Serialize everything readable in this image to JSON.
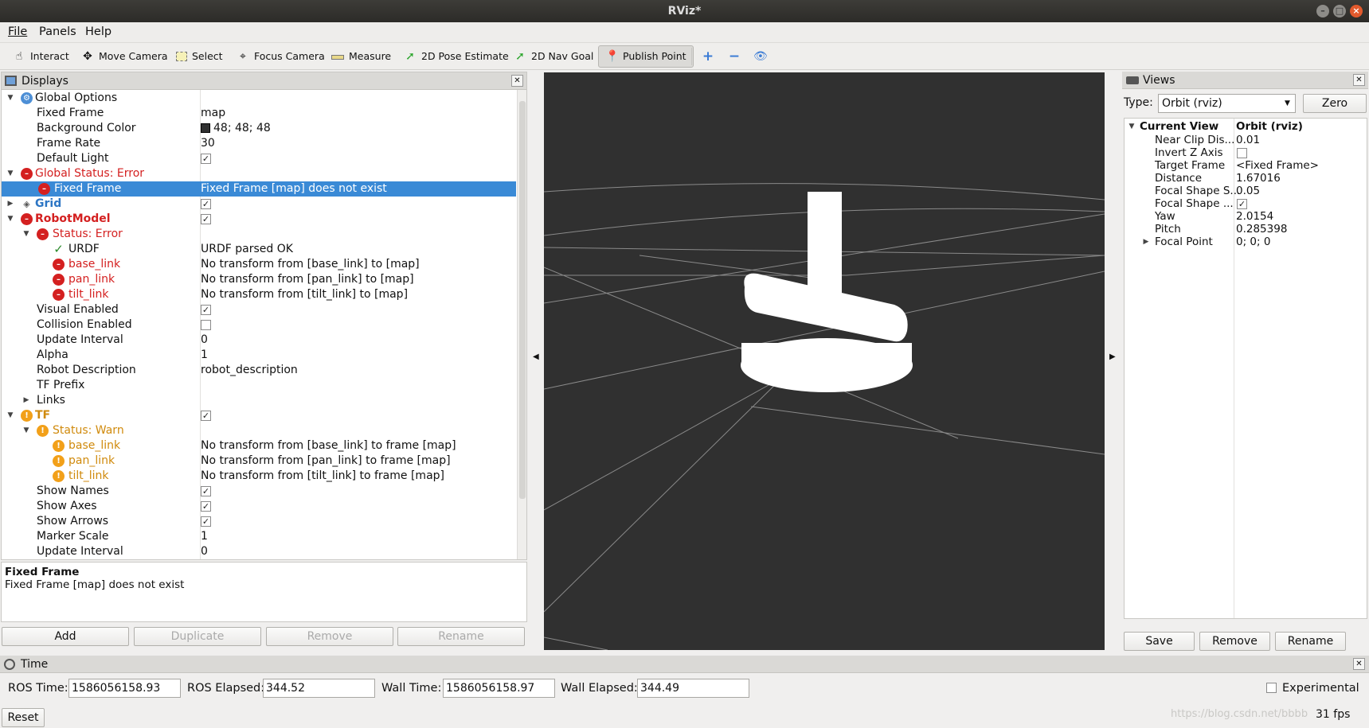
{
  "window": {
    "title": "RViz*"
  },
  "menu": {
    "file": "File",
    "panels": "Panels",
    "help": "Help"
  },
  "toolbar": {
    "interact": "Interact",
    "move_camera": "Move Camera",
    "select": "Select",
    "focus_camera": "Focus Camera",
    "measure": "Measure",
    "pose_estimate": "2D Pose Estimate",
    "nav_goal": "2D Nav Goal",
    "publish_point": "Publish Point",
    "active_tool": "Publish Point"
  },
  "displays": {
    "title": "Displays",
    "rows": [
      {
        "label": "Global Options",
        "value": ""
      },
      {
        "label": "Fixed Frame",
        "value": "map"
      },
      {
        "label": "Background Color",
        "value": "48; 48; 48"
      },
      {
        "label": "Frame Rate",
        "value": "30"
      },
      {
        "label": "Default Light",
        "value": ""
      },
      {
        "label": "Global Status: Error",
        "value": ""
      },
      {
        "label": "Fixed Frame",
        "value": "Fixed Frame [map] does not exist"
      },
      {
        "label": "Grid",
        "value": ""
      },
      {
        "label": "RobotModel",
        "value": ""
      },
      {
        "label": "Status: Error",
        "value": ""
      },
      {
        "label": "URDF",
        "value": "URDF parsed OK"
      },
      {
        "label": "base_link",
        "value": "No transform from [base_link] to [map]"
      },
      {
        "label": "pan_link",
        "value": "No transform from [pan_link] to [map]"
      },
      {
        "label": "tilt_link",
        "value": "No transform from [tilt_link] to [map]"
      },
      {
        "label": "Visual Enabled",
        "value": ""
      },
      {
        "label": "Collision Enabled",
        "value": ""
      },
      {
        "label": "Update Interval",
        "value": "0"
      },
      {
        "label": "Alpha",
        "value": "1"
      },
      {
        "label": "Robot Description",
        "value": "robot_description"
      },
      {
        "label": "TF Prefix",
        "value": ""
      },
      {
        "label": "Links",
        "value": ""
      },
      {
        "label": "TF",
        "value": ""
      },
      {
        "label": "Status: Warn",
        "value": ""
      },
      {
        "label": "base_link",
        "value": "No transform from [base_link] to frame [map]"
      },
      {
        "label": "pan_link",
        "value": "No transform from [pan_link] to frame [map]"
      },
      {
        "label": "tilt_link",
        "value": "No transform from [tilt_link] to frame [map]"
      },
      {
        "label": "Show Names",
        "value": ""
      },
      {
        "label": "Show Axes",
        "value": ""
      },
      {
        "label": "Show Arrows",
        "value": ""
      },
      {
        "label": "Marker Scale",
        "value": "1"
      },
      {
        "label": "Update Interval",
        "value": "0"
      }
    ],
    "checkboxes": {
      "default_light": true,
      "grid": true,
      "robotmodel": true,
      "visual_enabled": true,
      "collision_enabled": false,
      "tf": true,
      "show_names": true,
      "show_axes": true,
      "show_arrows": true
    },
    "background_color_hex": "#303030",
    "selected_row": "Fixed Frame"
  },
  "description": {
    "title": "Fixed Frame",
    "text": "Fixed Frame [map] does not exist"
  },
  "display_buttons": {
    "add": "Add",
    "duplicate": "Duplicate",
    "remove": "Remove",
    "rename": "Rename"
  },
  "views": {
    "title": "Views",
    "type_label": "Type:",
    "type_value": "Orbit (rviz)",
    "zero": "Zero",
    "current_view": {
      "label": "Current View",
      "value": "Orbit (rviz)"
    },
    "props": [
      {
        "label": "Near Clip Dis...",
        "value": "0.01"
      },
      {
        "label": "Invert Z Axis",
        "value": ""
      },
      {
        "label": "Target Frame",
        "value": "<Fixed Frame>"
      },
      {
        "label": "Distance",
        "value": "1.67016"
      },
      {
        "label": "Focal Shape S...",
        "value": "0.05"
      },
      {
        "label": "Focal Shape ...",
        "value": ""
      },
      {
        "label": "Yaw",
        "value": "2.0154"
      },
      {
        "label": "Pitch",
        "value": "0.285398"
      },
      {
        "label": "Focal Point",
        "value": "0; 0; 0"
      }
    ],
    "invert_z": false,
    "focal_shape_fixed": true,
    "save": "Save",
    "remove": "Remove",
    "rename": "Rename"
  },
  "time": {
    "title": "Time",
    "ros_time_label": "ROS Time:",
    "ros_time": "1586056158.93",
    "ros_elapsed_label": "ROS Elapsed:",
    "ros_elapsed": "344.52",
    "wall_time_label": "Wall Time:",
    "wall_time": "1586056158.97",
    "wall_elapsed_label": "Wall Elapsed:",
    "wall_elapsed": "344.49",
    "experimental": "Experimental",
    "reset": "Reset",
    "fps": "31 fps"
  },
  "watermark": "https://blog.csdn.net/bbbb"
}
